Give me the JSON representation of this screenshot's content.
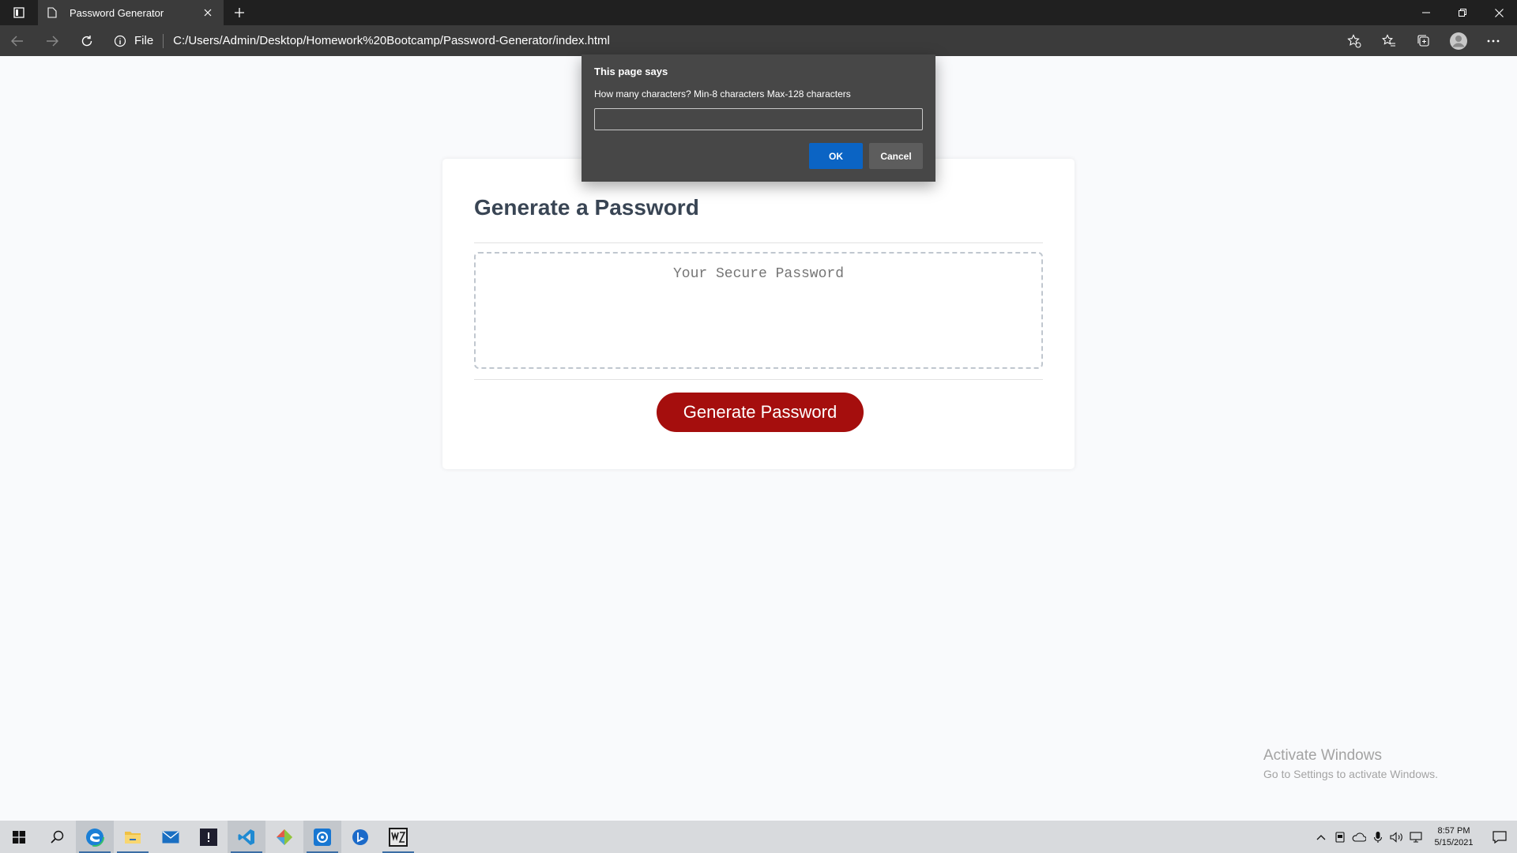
{
  "browser": {
    "tab_title": "Password Generator",
    "address_scheme": "File",
    "url": "C:/Users/Admin/Desktop/Homework%20Bootcamp/Password-Generator/index.html"
  },
  "page": {
    "header": "Generate a Password",
    "password_placeholder": "Your Secure Password",
    "generate_button": "Generate Password"
  },
  "dialog": {
    "title": "This page says",
    "message": "How many characters? Min-8 characters Max-128 characters",
    "input_value": "",
    "ok_label": "OK",
    "cancel_label": "Cancel"
  },
  "watermark": {
    "title": "Activate Windows",
    "subtitle": "Go to Settings to activate Windows."
  },
  "taskbar": {
    "time": "8:57 PM",
    "date": "5/15/2021",
    "apps": [
      "start-icon",
      "search-icon",
      "edge-icon",
      "file-explorer-icon",
      "mail-icon",
      "terminal-icon",
      "vscode-icon",
      "git-icon",
      "app-icon",
      "bing-icon",
      "warzone-icon"
    ]
  },
  "colors": {
    "accent": "#a50e0d",
    "dialog_ok": "#0b64c4",
    "browser_chrome": "#3b3b3b"
  }
}
